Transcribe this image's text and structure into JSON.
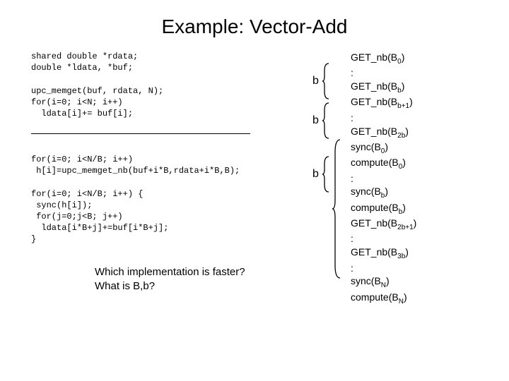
{
  "title": "Example: Vector-Add",
  "code1": "shared double *rdata;\ndouble *ldata, *buf;\n\nupc_memget(buf, rdata, N);\nfor(i=0; i<N; i++)\n  ldata[i]+= buf[i];",
  "code2": "for(i=0; i<N/B; i++)\n h[i]=upc_memget_nb(buf+i*B,rdata+i*B,B);\n\nfor(i=0; i<N/B; i++) {\n sync(h[i]);\n for(j=0;j<B; j++)\n  ldata[i*B+j]+=buf[i*B+j];\n}",
  "question_l1": "Which implementation is faster?",
  "question_l2": "What is B,b?",
  "b_label": "b",
  "right_items": [
    {
      "pre": "GET_nb(B",
      "sub": "0",
      "post": ")"
    },
    {
      "pre": ":",
      "sub": "",
      "post": ""
    },
    {
      "pre": "GET_nb(B",
      "sub": "b",
      "post": ")"
    },
    {
      "pre": "GET_nb(B",
      "sub": "b+1",
      "post": ")"
    },
    {
      "pre": ":",
      "sub": "",
      "post": ""
    },
    {
      "pre": "GET_nb(B",
      "sub": "2b",
      "post": ")"
    },
    {
      "pre": "sync(B",
      "sub": "0",
      "post": ")"
    },
    {
      "pre": "compute(B",
      "sub": "0",
      "post": ")"
    },
    {
      "pre": ":",
      "sub": "",
      "post": ""
    },
    {
      "pre": "sync(B",
      "sub": "b",
      "post": ")"
    },
    {
      "pre": "compute(B",
      "sub": "b",
      "post": ")"
    },
    {
      "pre": "GET_nb(B",
      "sub": "2b+1",
      "post": ")"
    },
    {
      "pre": ":",
      "sub": "",
      "post": ""
    },
    {
      "pre": "GET_nb(B",
      "sub": "3b",
      "post": ")"
    },
    {
      "pre": ":",
      "sub": "",
      "post": ""
    },
    {
      "pre": "sync(B",
      "sub": "N",
      "post": ")"
    },
    {
      "pre": "compute(B",
      "sub": "N",
      "post": ")"
    }
  ]
}
